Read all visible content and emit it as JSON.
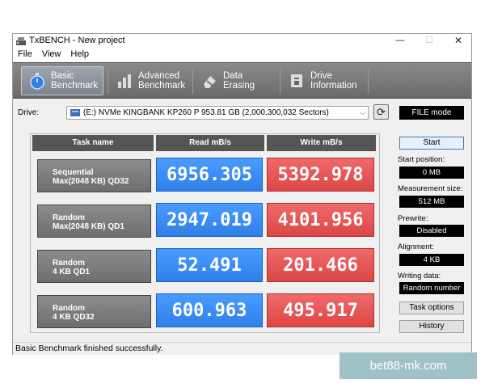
{
  "window": {
    "title": "TxBENCH - New project",
    "controls": {
      "minimize": "—",
      "maximize": "☐",
      "close": "✕"
    }
  },
  "menu": [
    "File",
    "View",
    "Help"
  ],
  "toolbar": {
    "tabs": [
      {
        "line1": "Basic",
        "line2": "Benchmark",
        "icon": "stopwatch-icon",
        "active": true
      },
      {
        "line1": "Advanced",
        "line2": "Benchmark",
        "icon": "bar-chart-icon",
        "active": false
      },
      {
        "line1": "Data Erasing",
        "line2": "",
        "icon": "eraser-icon",
        "active": false
      },
      {
        "line1": "Drive",
        "line2": "Information",
        "icon": "drive-info-icon",
        "active": false
      }
    ]
  },
  "drive": {
    "label": "Drive:",
    "selected": "(E:) NVMe KINGBANK KP260 P  953.81 GB (2,000,300,032 Sectors)",
    "mode": "FILE mode"
  },
  "results": {
    "headers": {
      "task": "Task name",
      "read": "Read mB/s",
      "write": "Write mB/s"
    },
    "rows": [
      {
        "name1": "Sequential",
        "name2": "Max(2048 KB) QD32",
        "read": "6956.305",
        "write": "5392.978"
      },
      {
        "name1": "Random",
        "name2": "Max(2048 KB) QD1",
        "read": "2947.019",
        "write": "4101.956"
      },
      {
        "name1": "Random",
        "name2": "4 KB QD1",
        "read": "52.491",
        "write": "201.466"
      },
      {
        "name1": "Random",
        "name2": "4 KB QD32",
        "read": "600.963",
        "write": "495.917"
      }
    ]
  },
  "side": {
    "start_label": "Start",
    "start_position": {
      "label": "Start position:",
      "value": "0 MB"
    },
    "measurement_size": {
      "label": "Measurement size:",
      "value": "512 MB"
    },
    "prewrite": {
      "label": "Prewrite:",
      "value": "Disabled"
    },
    "alignment": {
      "label": "Alignment:",
      "value": "4 KB"
    },
    "writing_data": {
      "label": "Writing data:",
      "value": "Random number"
    },
    "task_options_label": "Task options",
    "history_label": "History"
  },
  "status": "Basic Benchmark finished successfully.",
  "watermark": "bet88-mk.com",
  "colors": {
    "read": "#3a8cf5",
    "write": "#e65858",
    "toolbar": "#7a7a7a"
  }
}
